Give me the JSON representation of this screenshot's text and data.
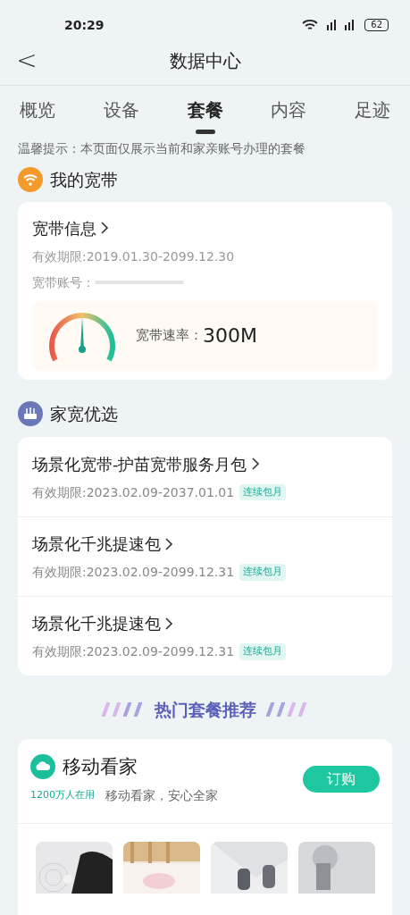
{
  "status_bar": {
    "time": "20:29",
    "battery": "62"
  },
  "header": {
    "back": "<",
    "title": "数据中心"
  },
  "tabs": [
    {
      "label": "概览",
      "selected": false
    },
    {
      "label": "设备",
      "selected": false
    },
    {
      "label": "套餐",
      "selected": true
    },
    {
      "label": "内容",
      "selected": false
    },
    {
      "label": "足迹",
      "selected": false
    }
  ],
  "notice": "温馨提示：本页面仅展示当前和家亲账号办理的套餐",
  "broadband": {
    "section_title": "我的宽带",
    "card_title": "宽带信息",
    "validity": "有效期限:2019.01.30-2099.12.30",
    "account_label": "宽带账号：",
    "speed_label": "宽带速率：",
    "speed": "300M"
  },
  "home": {
    "section_title": "家宽优选",
    "items": [
      {
        "title": "场景化宽带-护苗宽带服务月包",
        "validity": "有效期限:2023.02.09-2037.01.01",
        "tag": "连续包月"
      },
      {
        "title": "场景化千兆提速包",
        "validity": "有效期限:2023.02.09-2099.12.31",
        "tag": "连续包月"
      },
      {
        "title": "场景化千兆提速包",
        "validity": "有效期限:2023.02.09-2099.12.31",
        "tag": "连续包月"
      }
    ]
  },
  "hot": {
    "title": "热门套餐推荐",
    "product": {
      "name": "移动看家",
      "users": "1200万人在用",
      "slogan": "移动看家，安心全家",
      "button": "订购"
    }
  }
}
